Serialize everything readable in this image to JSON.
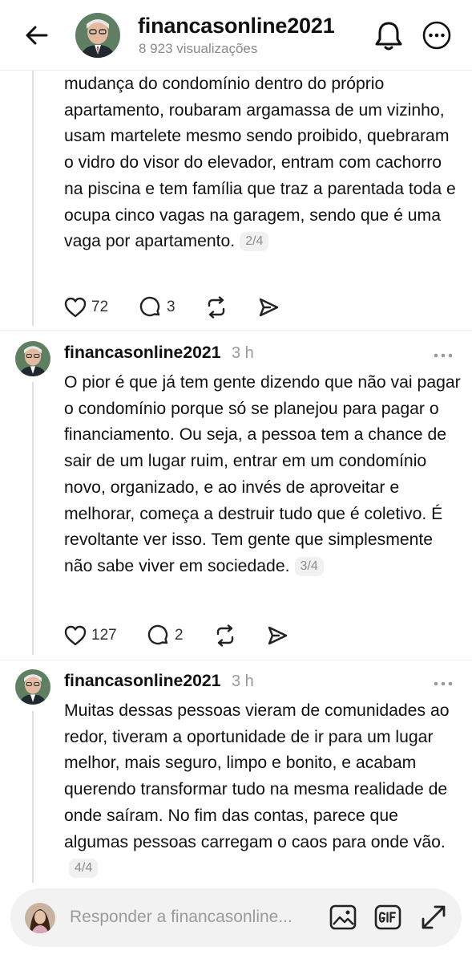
{
  "header": {
    "username": "financasonline2021",
    "views": "8 923 visualizações"
  },
  "post2": {
    "text": "mudança do condomínio dentro do próprio apartamento, roubaram argamassa de um vizinho, usam martelete mesmo sendo proibido, quebraram o vidro do visor do elevador, entram com cachorro na piscina e tem família que traz a parentada toda e ocupa cinco vagas na garagem, sendo que é uma vaga por apartamento.",
    "page": "2/4",
    "likes": "72",
    "replies": "3"
  },
  "post3": {
    "username": "financasonline2021",
    "time": "3 h",
    "text": "O pior é que já tem gente dizendo que não vai pagar o condomínio porque só se planejou para pagar o financiamento. Ou seja, a pessoa tem a chance de sair de um lugar ruim, entrar em um condomínio novo, organizado, e ao invés de aproveitar e melhorar, começa a destruir tudo que é coletivo. É revoltante ver isso. Tem gente que simplesmente não sabe viver em sociedade.",
    "page": "3/4",
    "likes": "127",
    "replies": "2"
  },
  "post4": {
    "username": "financasonline2021",
    "time": "3 h",
    "text": "Muitas dessas pessoas vieram de comunidades ao redor, tiveram a oportunidade de ir para um lugar melhor, mais seguro, limpo e bonito, e acabam querendo transformar tudo na mesma realidade de onde saíram. No fim das contas, parece que algumas pessoas carregam o caos para onde vão.",
    "page": "4/4"
  },
  "reply_bar": {
    "placeholder": "Responder a financasonline..."
  },
  "icons": [
    "back-arrow-icon",
    "bell-icon",
    "more-icon",
    "heart-icon",
    "comment-icon",
    "repost-icon",
    "share-icon",
    "image-icon",
    "gif-icon",
    "expand-icon"
  ],
  "colors": {
    "text": "#111111",
    "muted": "#8a8a8a",
    "thread_line": "#dedede",
    "reply_bar": "#f2f2f2"
  }
}
